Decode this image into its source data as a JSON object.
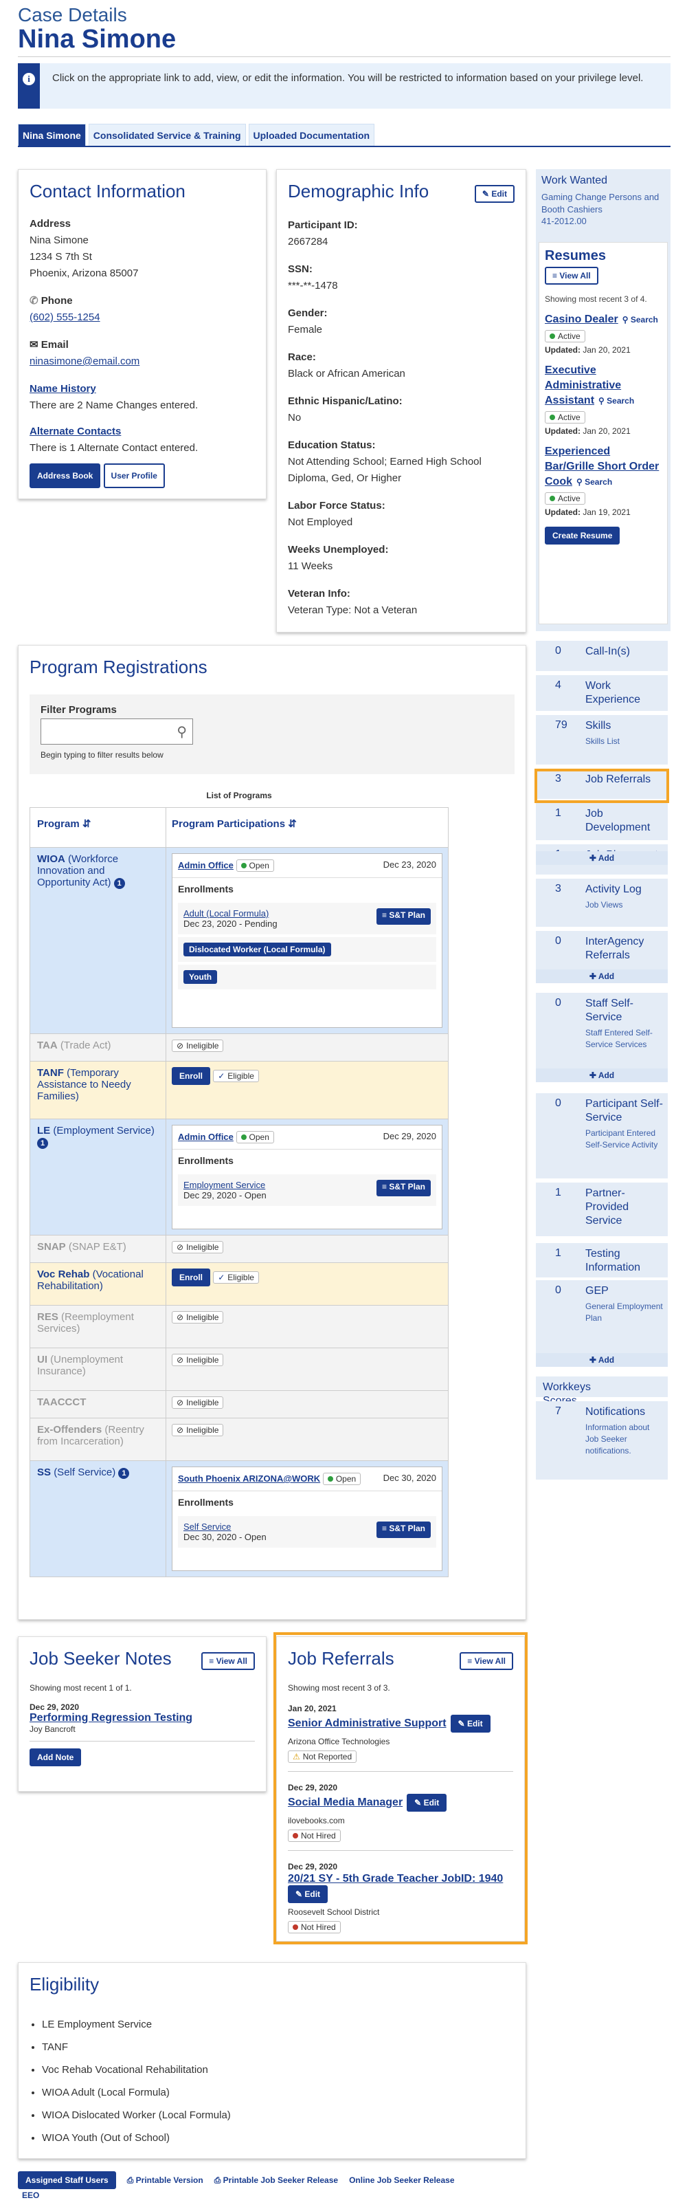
{
  "header": {
    "sub": "Case Details",
    "title": "Nina Simone"
  },
  "info_text": "Click on the appropriate link to add, view, or edit the information. You will be restricted to information based on your privilege level.",
  "tabs": [
    "Nina Simone",
    "Consolidated Service & Training",
    "Uploaded Documentation"
  ],
  "contact": {
    "title": "Contact Information",
    "address_label": "Address",
    "address": [
      "Nina Simone",
      "1234 S 7th St",
      "Phoenix, Arizona 85007"
    ],
    "phone_label": "Phone",
    "phone": "(602) 555-1254",
    "email_label": "Email",
    "email": "ninasimone@email.com",
    "name_history": "Name History",
    "name_history_text": "There are 2 Name Changes entered.",
    "alt_contacts": "Alternate Contacts",
    "alt_contacts_text": "There is 1 Alternate Contact entered.",
    "address_book": "Address Book",
    "user_profile": "User Profile"
  },
  "demo": {
    "title": "Demographic Info",
    "edit": "Edit",
    "fields": [
      {
        "label": "Participant ID:",
        "value": "2667284"
      },
      {
        "label": "SSN:",
        "value": "***-**-1478"
      },
      {
        "label": "Gender:",
        "value": "Female"
      },
      {
        "label": "Race:",
        "value": "Black or African American"
      },
      {
        "label": "Ethnic Hispanic/Latino:",
        "value": "No"
      },
      {
        "label": "Education Status:",
        "value": "Not Attending School; Earned High School Diploma, Ged, Or Higher"
      },
      {
        "label": "Labor Force Status:",
        "value": "Not Employed"
      },
      {
        "label": "Weeks Unemployed:",
        "value": "11 Weeks"
      },
      {
        "label": "Veteran Info:",
        "value": "Veteran Type: Not a Veteran"
      }
    ]
  },
  "work_wanted": {
    "title": "Work Wanted",
    "text": "Gaming Change Persons and Booth Cashiers",
    "code": "41-2012.00"
  },
  "resumes": {
    "title": "Resumes",
    "view_all": "View All",
    "showing": "Showing most recent 3 of 4.",
    "search": "Search",
    "updated_label": "Updated:",
    "create": "Create Resume",
    "items": [
      {
        "title": "Casino Dealer",
        "status": "Active",
        "updated": "Jan 20, 2021"
      },
      {
        "title": "Executive Administrative Assistant",
        "status": "Active",
        "updated": "Jan 20, 2021"
      },
      {
        "title": "Experienced Bar/Grille Short Order Cook",
        "status": "Active",
        "updated": "Jan 19, 2021"
      }
    ]
  },
  "sidebar": {
    "add": "Add",
    "items": [
      {
        "count": "0",
        "label": "Call-In(s)",
        "sub": ""
      },
      {
        "count": "4",
        "label": "Work Experience",
        "sub": ""
      },
      {
        "count": "79",
        "label": "Skills",
        "sub": "Skills List"
      },
      {
        "count": "3",
        "label": "Job Referrals",
        "sub": ""
      },
      {
        "count": "1",
        "label": "Job Development",
        "sub": ""
      },
      {
        "count": "1",
        "label": "Job Placement",
        "sub": ""
      },
      {
        "count": "3",
        "label": "Activity Log",
        "sub": "Job Views"
      },
      {
        "count": "0",
        "label": "InterAgency Referrals",
        "sub": ""
      },
      {
        "count": "0",
        "label": "Staff Self-Service",
        "sub": "Staff Entered Self-Service Services"
      },
      {
        "count": "0",
        "label": "Participant Self-Service",
        "sub": "Participant Entered Self-Service Activity"
      },
      {
        "count": "1",
        "label": "Partner-Provided Service",
        "sub": ""
      },
      {
        "count": "1",
        "label": "Testing Information",
        "sub": ""
      },
      {
        "count": "0",
        "label": "GEP",
        "sub": "General Employment Plan"
      },
      {
        "count": "",
        "label": "Workkeys Scores",
        "sub": ""
      },
      {
        "count": "7",
        "label": "Notifications",
        "sub": "Information about Job Seeker notifications."
      }
    ]
  },
  "programs": {
    "title": "Program Registrations",
    "filter_label": "Filter Programs",
    "filter_help": "Begin typing to filter results below",
    "caption": "List of Programs",
    "col1": "Program",
    "col2": "Program Participations",
    "enrollments": "Enrollments",
    "open": "Open",
    "ineligible": "Ineligible",
    "eligible": "Eligible",
    "enroll": "Enroll",
    "st_plan": "S&T Plan",
    "wioa": {
      "code": "WIOA",
      "name": "(Workforce Innovation and Opportunity Act)",
      "badge": "1",
      "office": "Admin Office",
      "date": "Dec 23, 2020",
      "enr_link": "Adult (Local Formula)",
      "enr_date": "Dec 23, 2020 - Pending",
      "tag1": "Dislocated Worker (Local Formula)",
      "tag2": "Youth"
    },
    "taa": {
      "code": "TAA",
      "name": "(Trade Act)"
    },
    "tanf": {
      "code": "TANF",
      "name": "(Temporary Assistance to Needy Families)"
    },
    "le": {
      "code": "LE",
      "name": "(Employment Service)",
      "badge": "1",
      "office": "Admin Office",
      "date": "Dec 29, 2020",
      "enr_link": "Employment Service",
      "enr_date": "Dec 29, 2020 - Open"
    },
    "snap": {
      "code": "SNAP",
      "name": "(SNAP E&T)"
    },
    "voc": {
      "code": "Voc Rehab",
      "name": "(Vocational Rehabilitation)"
    },
    "res": {
      "code": "RES",
      "name": "(Reemployment Services)"
    },
    "ui": {
      "code": "UI",
      "name": "(Unemployment Insurance)"
    },
    "taaccct": {
      "code": "TAACCCT",
      "name": ""
    },
    "exo": {
      "code": "Ex-Offenders",
      "name": "(Reentry from Incarceration)"
    },
    "ss": {
      "code": "SS",
      "name": "(Self Service)",
      "badge": "1",
      "office": "South Phoenix ARIZONA@WORK",
      "date": "Dec 30, 2020",
      "enr_link": "Self Service",
      "enr_date": "Dec 30, 2020 - Open"
    }
  },
  "notes": {
    "title": "Job Seeker Notes",
    "view_all": "View All",
    "showing": "Showing most recent 1 of 1.",
    "date": "Dec 29, 2020",
    "link": "Performing Regression Testing",
    "author": "Joy Bancroft",
    "add": "Add Note"
  },
  "referrals": {
    "title": "Job Referrals",
    "view_all": "View All",
    "showing": "Showing most recent 3 of 3.",
    "edit": "Edit",
    "items": [
      {
        "date": "Jan 20, 2021",
        "title": "Senior Administrative Support",
        "company": "Arizona Office Technologies",
        "status": "Not Reported"
      },
      {
        "date": "Dec 29, 2020",
        "title": "Social Media Manager",
        "company": "ilovebooks.com",
        "status": "Not Hired"
      },
      {
        "date": "Dec 29, 2020",
        "title": "20/21 SY - 5th Grade Teacher JobID: 1940",
        "company": "Roosevelt School District",
        "status": "Not Hired"
      }
    ]
  },
  "eligibility": {
    "title": "Eligibility",
    "items": [
      "LE Employment Service",
      "TANF",
      "Voc Rehab Vocational Rehabilitation",
      "WIOA Adult (Local Formula)",
      "WIOA Dislocated Worker (Local Formula)",
      "WIOA Youth (Out of School)"
    ]
  },
  "footer": {
    "assigned": "Assigned Staff Users",
    "printable": "Printable Version",
    "release": "Printable Job Seeker Release",
    "online": "Online Job Seeker Release",
    "eeo": "EEO"
  }
}
